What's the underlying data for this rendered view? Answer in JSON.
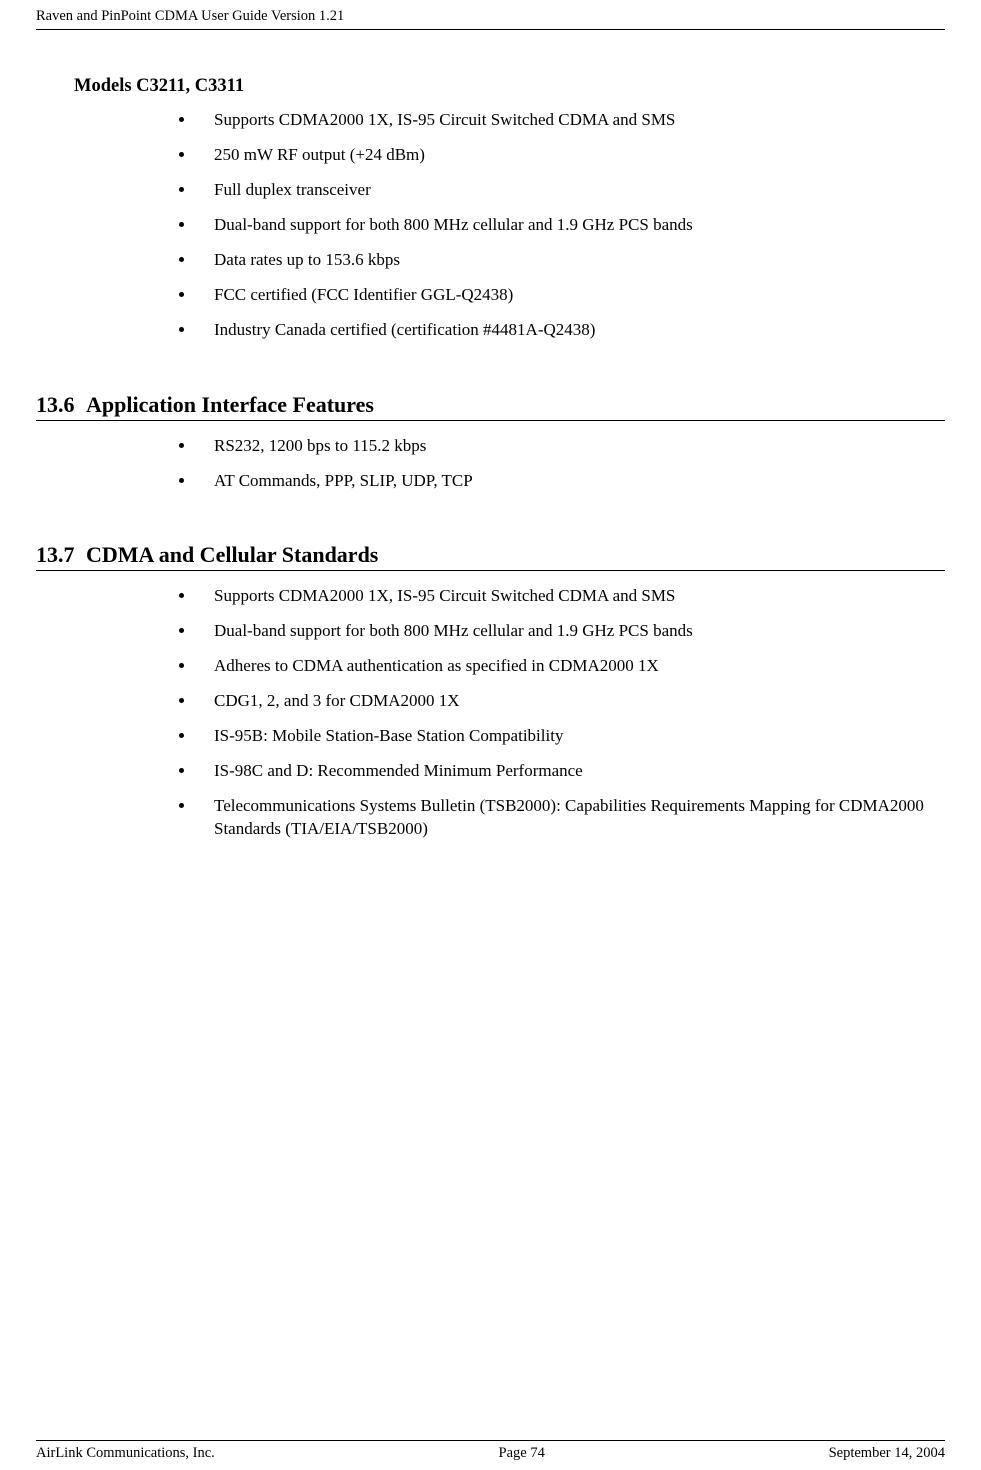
{
  "header": {
    "title": "Raven and PinPoint CDMA User Guide Version 1.21"
  },
  "section_models": {
    "heading": "Models C3211, C3311",
    "items": [
      "Supports CDMA2000 1X, IS-95 Circuit Switched CDMA and SMS",
      "250 mW RF output (+24 dBm)",
      "Full duplex transceiver",
      "Dual-band support for both 800 MHz cellular and 1.9 GHz PCS bands",
      "Data rates up to 153.6 kbps",
      "FCC certified (FCC Identifier GGL-Q2438)",
      "Industry Canada certified (certification #4481A-Q2438)"
    ]
  },
  "section_13_6": {
    "number": "13.6",
    "title": "Application Interface Features",
    "items": [
      "RS232, 1200 bps to 115.2 kbps",
      "AT Commands, PPP, SLIP, UDP, TCP"
    ]
  },
  "section_13_7": {
    "number": "13.7",
    "title": "CDMA and Cellular Standards",
    "items": [
      "Supports CDMA2000 1X, IS-95 Circuit Switched CDMA and SMS",
      "Dual-band support for both 800 MHz cellular and 1.9 GHz PCS bands",
      "Adheres to CDMA authentication as specified in CDMA2000 1X",
      "CDG1, 2, and 3 for CDMA2000 1X",
      "IS-95B: Mobile Station-Base Station Compatibility",
      "IS-98C and D: Recommended Minimum Performance",
      "Telecommunications Systems Bulletin (TSB2000): Capabilities Requirements Mapping for CDMA2000 Standards (TIA/EIA/TSB2000)"
    ]
  },
  "footer": {
    "company": "AirLink Communications, Inc.",
    "page": "Page 74",
    "date": "September 14, 2004"
  }
}
